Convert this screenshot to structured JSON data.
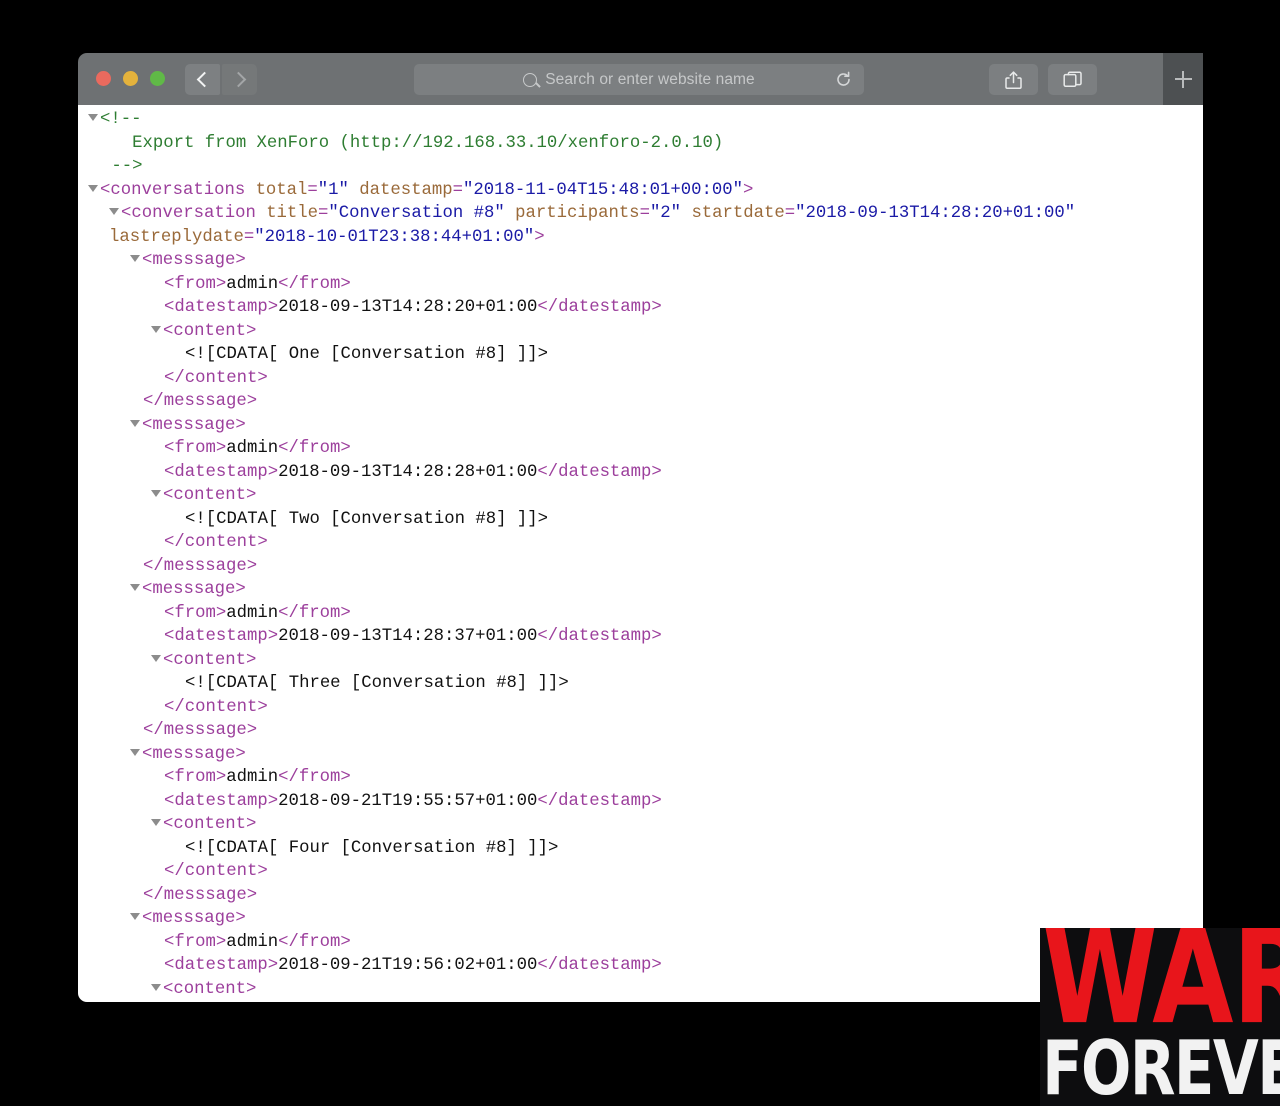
{
  "browser": {
    "window_controls": [
      {
        "name": "close",
        "color": "#ea6a5e"
      },
      {
        "name": "minimize",
        "color": "#e4b23c"
      },
      {
        "name": "maximize",
        "color": "#60b947"
      }
    ],
    "back_label": "‹",
    "forward_label": "›",
    "address": {
      "value": "",
      "placeholder": "Search or enter website name",
      "search_icon": "search-icon",
      "reload_icon": "reload-icon"
    },
    "share_icon": "share-icon",
    "tabs_icon": "tab-overview-icon",
    "new_tab_label": "+"
  },
  "xml": {
    "lines": [
      {
        "indent": 0,
        "triangle": true,
        "tokens": [
          {
            "c": "tok-comment",
            "t": "<!--"
          }
        ]
      },
      {
        "indent": 0,
        "triangle": false,
        "tokens": [
          {
            "c": "tok-comment",
            "t": "   Export from XenForo (http://192.168.33.10/xenforo-2.0.10)"
          }
        ]
      },
      {
        "indent": 0,
        "triangle": false,
        "tokens": [
          {
            "c": "tok-comment",
            "t": " -->"
          }
        ]
      },
      {
        "indent": 0,
        "triangle": true,
        "tokens": [
          {
            "c": "tok-tag",
            "t": "<conversations "
          },
          {
            "c": "tok-attr",
            "t": "total"
          },
          {
            "c": "tok-tag",
            "t": "="
          },
          {
            "c": "tok-val",
            "t": "\"1\""
          },
          {
            "c": "tok-tag",
            "t": " "
          },
          {
            "c": "tok-attr",
            "t": "datestamp"
          },
          {
            "c": "tok-tag",
            "t": "="
          },
          {
            "c": "tok-val",
            "t": "\"2018-11-04T15:48:01+00:00\""
          },
          {
            "c": "tok-tag",
            "t": ">"
          }
        ]
      },
      {
        "indent": 1,
        "triangle": true,
        "wrap": true,
        "tokens": [
          {
            "c": "tok-tag",
            "t": "<conversation "
          },
          {
            "c": "tok-attr",
            "t": "title"
          },
          {
            "c": "tok-tag",
            "t": "="
          },
          {
            "c": "tok-val",
            "t": "\"Conversation #8\""
          },
          {
            "c": "tok-tag",
            "t": " "
          },
          {
            "c": "tok-attr",
            "t": "participants"
          },
          {
            "c": "tok-tag",
            "t": "="
          },
          {
            "c": "tok-val",
            "t": "\"2\""
          },
          {
            "c": "tok-tag",
            "t": " "
          },
          {
            "c": "tok-attr",
            "t": "startdate"
          },
          {
            "c": "tok-tag",
            "t": "="
          },
          {
            "c": "tok-val",
            "t": "\"2018-09-13T14:28:20+01:00\""
          },
          {
            "c": "tok-tag",
            "t": " "
          },
          {
            "c": "tok-attr",
            "t": "lastreplydate"
          },
          {
            "c": "tok-tag",
            "t": "="
          },
          {
            "c": "tok-val",
            "t": "\"2018-10-01T23:38:44+01:00\""
          },
          {
            "c": "tok-tag",
            "t": ">"
          }
        ]
      },
      {
        "indent": 2,
        "triangle": true,
        "tokens": [
          {
            "c": "tok-tag",
            "t": "<messsage>"
          }
        ]
      },
      {
        "indent": 3,
        "triangle": false,
        "tokens": [
          {
            "c": "tok-tag",
            "t": "<from>"
          },
          {
            "c": "tok-text",
            "t": "admin"
          },
          {
            "c": "tok-tag",
            "t": "</from>"
          }
        ]
      },
      {
        "indent": 3,
        "triangle": false,
        "tokens": [
          {
            "c": "tok-tag",
            "t": "<datestamp>"
          },
          {
            "c": "tok-text",
            "t": "2018-09-13T14:28:20+01:00"
          },
          {
            "c": "tok-tag",
            "t": "</datestamp>"
          }
        ]
      },
      {
        "indent": 3,
        "triangle": true,
        "tokens": [
          {
            "c": "tok-tag",
            "t": "<content>"
          }
        ]
      },
      {
        "indent": 4,
        "triangle": false,
        "tokens": [
          {
            "c": "tok-cdata",
            "t": "<![CDATA[ One [Conversation #8] ]]>"
          }
        ]
      },
      {
        "indent": 3,
        "triangle": false,
        "tokens": [
          {
            "c": "tok-tag",
            "t": "</content>"
          }
        ]
      },
      {
        "indent": 2,
        "triangle": false,
        "tokens": [
          {
            "c": "tok-tag",
            "t": "</messsage>"
          }
        ]
      },
      {
        "indent": 2,
        "triangle": true,
        "tokens": [
          {
            "c": "tok-tag",
            "t": "<messsage>"
          }
        ]
      },
      {
        "indent": 3,
        "triangle": false,
        "tokens": [
          {
            "c": "tok-tag",
            "t": "<from>"
          },
          {
            "c": "tok-text",
            "t": "admin"
          },
          {
            "c": "tok-tag",
            "t": "</from>"
          }
        ]
      },
      {
        "indent": 3,
        "triangle": false,
        "tokens": [
          {
            "c": "tok-tag",
            "t": "<datestamp>"
          },
          {
            "c": "tok-text",
            "t": "2018-09-13T14:28:28+01:00"
          },
          {
            "c": "tok-tag",
            "t": "</datestamp>"
          }
        ]
      },
      {
        "indent": 3,
        "triangle": true,
        "tokens": [
          {
            "c": "tok-tag",
            "t": "<content>"
          }
        ]
      },
      {
        "indent": 4,
        "triangle": false,
        "tokens": [
          {
            "c": "tok-cdata",
            "t": "<![CDATA[ Two [Conversation #8] ]]>"
          }
        ]
      },
      {
        "indent": 3,
        "triangle": false,
        "tokens": [
          {
            "c": "tok-tag",
            "t": "</content>"
          }
        ]
      },
      {
        "indent": 2,
        "triangle": false,
        "tokens": [
          {
            "c": "tok-tag",
            "t": "</messsage>"
          }
        ]
      },
      {
        "indent": 2,
        "triangle": true,
        "tokens": [
          {
            "c": "tok-tag",
            "t": "<messsage>"
          }
        ]
      },
      {
        "indent": 3,
        "triangle": false,
        "tokens": [
          {
            "c": "tok-tag",
            "t": "<from>"
          },
          {
            "c": "tok-text",
            "t": "admin"
          },
          {
            "c": "tok-tag",
            "t": "</from>"
          }
        ]
      },
      {
        "indent": 3,
        "triangle": false,
        "tokens": [
          {
            "c": "tok-tag",
            "t": "<datestamp>"
          },
          {
            "c": "tok-text",
            "t": "2018-09-13T14:28:37+01:00"
          },
          {
            "c": "tok-tag",
            "t": "</datestamp>"
          }
        ]
      },
      {
        "indent": 3,
        "triangle": true,
        "tokens": [
          {
            "c": "tok-tag",
            "t": "<content>"
          }
        ]
      },
      {
        "indent": 4,
        "triangle": false,
        "tokens": [
          {
            "c": "tok-cdata",
            "t": "<![CDATA[ Three [Conversation #8] ]]>"
          }
        ]
      },
      {
        "indent": 3,
        "triangle": false,
        "tokens": [
          {
            "c": "tok-tag",
            "t": "</content>"
          }
        ]
      },
      {
        "indent": 2,
        "triangle": false,
        "tokens": [
          {
            "c": "tok-tag",
            "t": "</messsage>"
          }
        ]
      },
      {
        "indent": 2,
        "triangle": true,
        "tokens": [
          {
            "c": "tok-tag",
            "t": "<messsage>"
          }
        ]
      },
      {
        "indent": 3,
        "triangle": false,
        "tokens": [
          {
            "c": "tok-tag",
            "t": "<from>"
          },
          {
            "c": "tok-text",
            "t": "admin"
          },
          {
            "c": "tok-tag",
            "t": "</from>"
          }
        ]
      },
      {
        "indent": 3,
        "triangle": false,
        "tokens": [
          {
            "c": "tok-tag",
            "t": "<datestamp>"
          },
          {
            "c": "tok-text",
            "t": "2018-09-21T19:55:57+01:00"
          },
          {
            "c": "tok-tag",
            "t": "</datestamp>"
          }
        ]
      },
      {
        "indent": 3,
        "triangle": true,
        "tokens": [
          {
            "c": "tok-tag",
            "t": "<content>"
          }
        ]
      },
      {
        "indent": 4,
        "triangle": false,
        "tokens": [
          {
            "c": "tok-cdata",
            "t": "<![CDATA[ Four [Conversation #8] ]]>"
          }
        ]
      },
      {
        "indent": 3,
        "triangle": false,
        "tokens": [
          {
            "c": "tok-tag",
            "t": "</content>"
          }
        ]
      },
      {
        "indent": 2,
        "triangle": false,
        "tokens": [
          {
            "c": "tok-tag",
            "t": "</messsage>"
          }
        ]
      },
      {
        "indent": 2,
        "triangle": true,
        "tokens": [
          {
            "c": "tok-tag",
            "t": "<messsage>"
          }
        ]
      },
      {
        "indent": 3,
        "triangle": false,
        "tokens": [
          {
            "c": "tok-tag",
            "t": "<from>"
          },
          {
            "c": "tok-text",
            "t": "admin"
          },
          {
            "c": "tok-tag",
            "t": "</from>"
          }
        ]
      },
      {
        "indent": 3,
        "triangle": false,
        "tokens": [
          {
            "c": "tok-tag",
            "t": "<datestamp>"
          },
          {
            "c": "tok-text",
            "t": "2018-09-21T19:56:02+01:00"
          },
          {
            "c": "tok-tag",
            "t": "</datestamp>"
          }
        ]
      },
      {
        "indent": 3,
        "triangle": true,
        "tokens": [
          {
            "c": "tok-tag",
            "t": "<content>"
          }
        ]
      }
    ]
  },
  "watermark": {
    "line1": "WAR",
    "line2": "FOREVER",
    "color_line1": "#e8151b",
    "color_line2": "#f2f2f2",
    "background": "#0d0d0f"
  }
}
